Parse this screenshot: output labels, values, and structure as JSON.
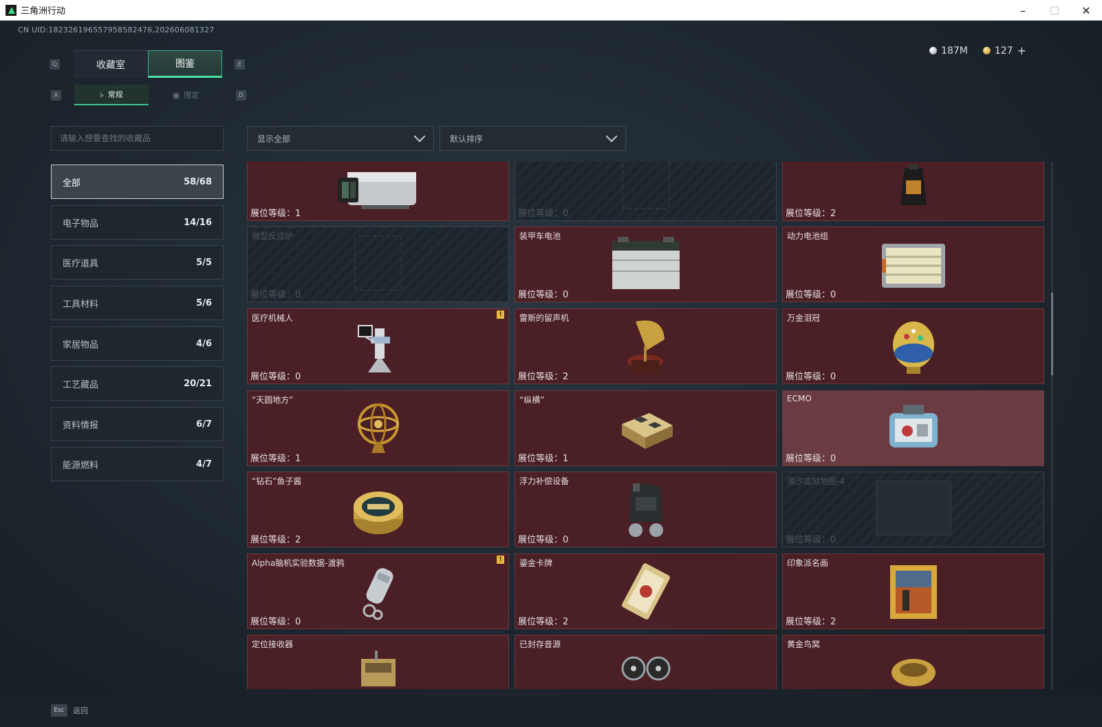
{
  "window": {
    "title": "三角洲行动"
  },
  "header": {
    "uid": "CN UID:182326196557958582476,202606081327",
    "currency": {
      "silver": "187M",
      "gold": "127"
    }
  },
  "tabs": {
    "main": [
      {
        "label": "收藏室",
        "key": "Q"
      },
      {
        "label": "图鉴",
        "key": "E"
      }
    ],
    "sub": [
      {
        "label": "常规",
        "key": "A"
      },
      {
        "label": "限定",
        "key": "D"
      }
    ]
  },
  "search": {
    "placeholder": "请输入想要查找的收藏品"
  },
  "filters": {
    "display": "显示全部",
    "sort": "默认排序"
  },
  "categories": [
    {
      "label": "全部",
      "count": "58/68"
    },
    {
      "label": "电子物品",
      "count": "14/16"
    },
    {
      "label": "医疗道具",
      "count": "5/5"
    },
    {
      "label": "工具材料",
      "count": "5/6"
    },
    {
      "label": "家居物品",
      "count": "4/6"
    },
    {
      "label": "工艺藏品",
      "count": "20/21"
    },
    {
      "label": "资料情报",
      "count": "6/7"
    },
    {
      "label": "能源燃料",
      "count": "4/7"
    }
  ],
  "items": [
    {
      "name": "",
      "level": "展位等级：1",
      "icon": "thermal-camera-icon"
    },
    {
      "name": "",
      "level": "展位等级：0",
      "icon": "locked-item-icon"
    },
    {
      "name": "",
      "level": "展位等级：2",
      "icon": "coffee-bag-icon"
    },
    {
      "name": "微型反应炉",
      "level": "展位等级：0",
      "icon": "micro-reactor-icon"
    },
    {
      "name": "装甲车电池",
      "level": "展位等级：0",
      "icon": "vehicle-battery-icon"
    },
    {
      "name": "动力电池组",
      "level": "展位等级：0",
      "icon": "battery-pack-icon"
    },
    {
      "name": "医疗机械人",
      "level": "展位等级：0",
      "icon": "medical-robot-icon"
    },
    {
      "name": "雷斯的留声机",
      "level": "展位等级：2",
      "icon": "gramophone-icon"
    },
    {
      "name": "万金泪冠",
      "level": "展位等级：0",
      "icon": "jeweled-egg-icon"
    },
    {
      "name": "“天圆地方”",
      "level": "展位等级：1",
      "icon": "armillary-sphere-icon"
    },
    {
      "name": "“纵横”",
      "level": "展位等级：1",
      "icon": "chess-box-icon"
    },
    {
      "name": "ECMO",
      "level": "展位等级：0",
      "icon": "ecmo-machine-icon"
    },
    {
      "name": "“钻石”鱼子酱",
      "level": "展位等级：2",
      "icon": "caviar-tin-icon"
    },
    {
      "name": "浮力补偿设备",
      "level": "展位等级：0",
      "icon": "buoyancy-device-icon"
    },
    {
      "name": "潮汐监狱地图-4",
      "level": "展位等级：0",
      "icon": "prison-map-icon"
    },
    {
      "name": "Alpha脑机实验数据-渡鸦",
      "level": "展位等级：0",
      "icon": "data-drive-icon"
    },
    {
      "name": "鎏金卡牌",
      "level": "展位等级：2",
      "icon": "gilded-card-icon"
    },
    {
      "name": "印象派名画",
      "level": "展位等级：2",
      "icon": "framed-painting-icon"
    },
    {
      "name": "定位接收器",
      "level": "",
      "icon": "locator-receiver-icon"
    },
    {
      "name": "已封存音源",
      "level": "",
      "icon": "reel-tape-icon"
    },
    {
      "name": "黄金鸟窝",
      "level": "",
      "icon": "golden-nest-icon"
    }
  ],
  "footer": {
    "esc_key": "Esc",
    "esc_label": "返回"
  },
  "colors": {
    "accent": "#4fe0a8",
    "card_bg": "#4a1f25",
    "card_border": "#6b3a40",
    "warning": "#e6b83c"
  }
}
